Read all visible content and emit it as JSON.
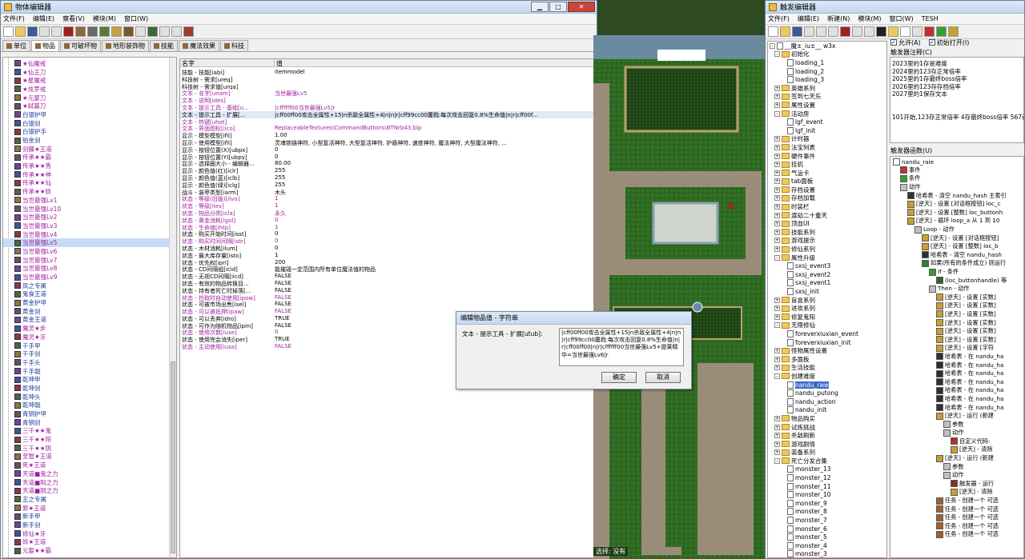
{
  "object_editor": {
    "title": "物体编辑器",
    "menu": [
      "文件(F)",
      "编辑(E)",
      "察看(V)",
      "模块(M)",
      "窗口(W)"
    ],
    "tabs": [
      "单位",
      "物品",
      "可破坏物",
      "地形装饰物",
      "技能",
      "魔法效果",
      "科技"
    ],
    "active_tab": "物品",
    "item_list": [
      "★仙魔戒",
      "★仙王刀",
      "★星魔戒",
      "★炫罗戒",
      "★元婴刀",
      "★弑墓刀",
      "白银护甲",
      "白银剑",
      "白银护手",
      "铂金剑",
      "剑藤★王道",
      "传承★★霸",
      "传承★★秀",
      "传承★★神",
      "传承★★仙",
      "传承★★妖",
      "当世最强Lv1",
      "当世最强Lv10",
      "当世最强Lv2",
      "当世最强Lv3",
      "当世最强Lv4",
      "当世最强Lv5",
      "当世最强Lv6",
      "当世最强Lv7",
      "当世最强Lv8",
      "当世最强Lv9",
      "凤之专属",
      "鬼食王道",
      "黄金护甲",
      "黄金剑",
      "黄金王道",
      "魔灵★步",
      "魔灵★牙",
      "千手甲",
      "千手剑",
      "千手头",
      "千手戟",
      "乾坤甲",
      "乾坤剑",
      "乾坤头",
      "乾坤戟",
      "青铜护甲",
      "青铜剑",
      "三千★★鬼",
      "三千★★阳",
      "三千★★阴",
      "至智★王道",
      "死★王道",
      "天道■鬼之力",
      "天道■阳之力",
      "天道■阴之力",
      "王之专属",
      "邪★王道",
      "新手甲",
      "新手剑",
      "修仙★牙",
      "妖★王道",
      "元婴★★霸"
    ],
    "selected_item": "当世最强Lv5",
    "grid_headers": [
      "名字",
      "值"
    ],
    "properties": [
      {
        "k": "技能 - 技能[iabi]",
        "v": "itemmodel",
        "mod": false
      },
      {
        "k": "科技树 - 需求[ureq]",
        "v": "",
        "mod": false
      },
      {
        "k": "科技树 - 需求值[urqa]",
        "v": "",
        "mod": false
      },
      {
        "k": "文本 - 名字[unam]",
        "v": "当世最强Lv5",
        "mod": true
      },
      {
        "k": "文本 - 说明[ides]",
        "v": "",
        "mod": true
      },
      {
        "k": "文本 - 提示工具 - 基础[u...",
        "v": "|cffffff00当世最强Lv5|r",
        "mod": true
      },
      {
        "k": "文本 - 提示工具 - 扩展[...",
        "v": "|cff00ff00攻击全属性+15|n杀敌全属性+4|n|n|r|cff99cc00屠戮:每次攻击回复0.8%生命值|n|r|cff00f...",
        "mod": false,
        "sel": true
      },
      {
        "k": "文本 - 热键[uhot]",
        "v": "",
        "mod": true
      },
      {
        "k": "文本 - 界面图标[iico]",
        "v": "ReplaceableTextures\\CommandButtons\\BTNrb43.blp",
        "mod": true
      },
      {
        "k": "显示 - 模型模型[ifil]",
        "v": "1.00",
        "mod": false
      },
      {
        "k": "显示 - 使用模型[ifil]",
        "v": "灵魂锁链神符, 小型复活神符, 大型复活神符, 护盾神符, 速度神符, 魔法神符, 大型魔法神符, ...",
        "mod": false
      },
      {
        "k": "显示 - 按钮位置(X)[ubpx]",
        "v": "0",
        "mod": false
      },
      {
        "k": "显示 - 按钮位置(Y)[ubpy]",
        "v": "0",
        "mod": false
      },
      {
        "k": "显示 - 选择圈大小 - 编辑器...",
        "v": "80.00",
        "mod": false
      },
      {
        "k": "显示 - 颜色值(红)[iclr]",
        "v": "255",
        "mod": false
      },
      {
        "k": "显示 - 颜色值(蓝)[iclb]",
        "v": "255",
        "mod": false
      },
      {
        "k": "显示 - 颜色值(绿)[iclg]",
        "v": "255",
        "mod": false
      },
      {
        "k": "战斗 - 装甲类型[iarm]",
        "v": "木头",
        "mod": false
      },
      {
        "k": "状态 - 等级(旧版)[ilvo]",
        "v": "1",
        "mod": true
      },
      {
        "k": "状态 - 等级[ilev]",
        "v": "1",
        "mod": true
      },
      {
        "k": "状态 - 物品分类[icla]",
        "v": "永久",
        "mod": true
      },
      {
        "k": "状态 - 黄金消耗[igol]",
        "v": "0",
        "mod": true
      },
      {
        "k": "状态 - 生命值[ihtp]",
        "v": "1",
        "mod": true
      },
      {
        "k": "状态 - 购买开始时间[isst]",
        "v": "0",
        "mod": false
      },
      {
        "k": "状态 - 购买时间间隔[istr]",
        "v": "0",
        "mod": true
      },
      {
        "k": "状态 - 木材消耗[ilum]",
        "v": "0",
        "mod": false
      },
      {
        "k": "状态 - 最大库存量[isto]",
        "v": "1",
        "mod": false
      },
      {
        "k": "状态 - 优先权[ipri]",
        "v": "200",
        "mod": false
      },
      {
        "k": "状态 - CD间隔组[icid]",
        "v": "能摧毁一定范围内所有单位魔法值的物品",
        "mod": false
      },
      {
        "k": "状态 - 无视CD间隔[iicd]",
        "v": "FALSE",
        "mod": false
      },
      {
        "k": "状态 - 有效的物品转换目...",
        "v": "FALSE",
        "mod": false
      },
      {
        "k": "状态 - 持有者死亡时掉落[...",
        "v": "FALSE",
        "mod": false
      },
      {
        "k": "状态 - 捡取时自动使用[ipow]",
        "v": "FALSE",
        "mod": true
      },
      {
        "k": "状态 - 可被市场出售[isel]",
        "v": "FALSE",
        "mod": false
      },
      {
        "k": "状态 - 可以被抵押[ipaw]",
        "v": "FALSE",
        "mod": true
      },
      {
        "k": "状态 - 可以丢弃[idro]",
        "v": "TRUE",
        "mod": false
      },
      {
        "k": "状态 - 可作为随机物品[iprn]",
        "v": "FALSE",
        "mod": false
      },
      {
        "k": "状态 - 使用次数[iuse]",
        "v": "0",
        "mod": true
      },
      {
        "k": "状态 - 使用完会消失[iper]",
        "v": "TRUE",
        "mod": false
      },
      {
        "k": "状态 - 主动使用[iusa]",
        "v": "FALSE",
        "mod": true
      }
    ]
  },
  "dialog": {
    "title": "编辑物品值 - 字符串",
    "label": "文本 - 提示工具 - 扩展[utub]:",
    "text": "|cff00ff00攻击全属性+15|n杀敌全属性+4|n|n|r|cff99cc00屠戮:每次攻击回复0.8%生命值|n|r|cff00ff00|n|r|cffffff00当世最强Lv5+提莱精华=当世最强Lv6|r",
    "ok": "确定",
    "cancel": "取消"
  },
  "trigger_editor": {
    "title": "触发编辑器",
    "menu": [
      "文件(F)",
      "编辑(E)",
      "新建(N)",
      "模块(M)",
      "窗口(W)",
      "TESH"
    ],
    "map_name": "__魔±_iu±__ w3x",
    "checkbox_enabled": "允许(A)",
    "checkbox_initial": "初始打开(I)",
    "comment_label": "触发器注释(C)",
    "comment_lines": [
      "2023里的1存是难度",
      "2024里的123存正常倍率",
      "2025里的1存最终boss倍率",
      "2026里的123存存档倍率",
      "2027里的1保存文本",
      "",
      "",
      "101开始,123存正常倍率 4存最终boss倍率 567存"
    ],
    "functions_label": "触发器函数(U)",
    "status": "选择: 没有",
    "tree": [
      {
        "t": "f",
        "l": "初始化",
        "d": 0,
        "e": "-"
      },
      {
        "t": "d",
        "l": "loading_1",
        "d": 1
      },
      {
        "t": "d",
        "l": "loading_2",
        "d": 1
      },
      {
        "t": "d",
        "l": "loading_3",
        "d": 1
      },
      {
        "t": "f",
        "l": "英雄系列",
        "d": 0,
        "e": "+"
      },
      {
        "t": "f",
        "l": "签到七天乐",
        "d": 0,
        "e": "+"
      },
      {
        "t": "f",
        "l": "属性设置",
        "d": 0,
        "e": "+"
      },
      {
        "t": "f",
        "l": "活动房",
        "d": 0,
        "e": "-"
      },
      {
        "t": "d",
        "l": "lgf_event",
        "d": 1
      },
      {
        "t": "d",
        "l": "lgf_init",
        "d": 1
      },
      {
        "t": "f",
        "l": "计时器",
        "d": 0,
        "e": "+"
      },
      {
        "t": "f",
        "l": "法宝列表",
        "d": 0,
        "e": "+"
      },
      {
        "t": "f",
        "l": "硬件事件",
        "d": 0,
        "e": "+"
      },
      {
        "t": "f",
        "l": "挂机",
        "d": 0,
        "e": "+"
      },
      {
        "t": "f",
        "l": "气运卡",
        "d": 0,
        "e": "+"
      },
      {
        "t": "f",
        "l": "tab面板",
        "d": 0,
        "e": "+"
      },
      {
        "t": "f",
        "l": "存档设置",
        "d": 0,
        "e": "+"
      },
      {
        "t": "f",
        "l": "存档加载",
        "d": 0,
        "e": "+"
      },
      {
        "t": "f",
        "l": "时装栏",
        "d": 0,
        "e": "+"
      },
      {
        "t": "f",
        "l": "渡劫二十重天",
        "d": 0,
        "e": "+"
      },
      {
        "t": "f",
        "l": "顶血UI",
        "d": 0,
        "e": "+"
      },
      {
        "t": "f",
        "l": "技能系列",
        "d": 0,
        "e": "+"
      },
      {
        "t": "f",
        "l": "游戏提示",
        "d": 0,
        "e": "+"
      },
      {
        "t": "f",
        "l": "修仙系列",
        "d": 0,
        "e": "+"
      },
      {
        "t": "f",
        "l": "属性升级",
        "d": 0,
        "e": "-"
      },
      {
        "t": "d",
        "l": "sxsj_event3",
        "d": 1
      },
      {
        "t": "d",
        "l": "sxsj_event2",
        "d": 1
      },
      {
        "t": "d",
        "l": "sxsj_event1",
        "d": 1
      },
      {
        "t": "d",
        "l": "sxsj_init",
        "d": 1
      },
      {
        "t": "f",
        "l": "盲盒系列",
        "d": 0,
        "e": "+"
      },
      {
        "t": "f",
        "l": "进攻系列",
        "d": 0,
        "e": "+"
      },
      {
        "t": "f",
        "l": "修复鬼阳",
        "d": 0,
        "e": "+"
      },
      {
        "t": "f",
        "l": "无限修仙",
        "d": 0,
        "e": "-"
      },
      {
        "t": "d",
        "l": "foreverxiuxian_event",
        "d": 1
      },
      {
        "t": "d",
        "l": "foreverxiuxian_init",
        "d": 1
      },
      {
        "t": "f",
        "l": "怪物属性设置",
        "d": 0,
        "e": "+"
      },
      {
        "t": "f",
        "l": "多面板",
        "d": 0,
        "e": "+"
      },
      {
        "t": "f",
        "l": "生活技能",
        "d": 0,
        "e": "+"
      },
      {
        "t": "f",
        "l": "创建难度",
        "d": 0,
        "e": "-"
      },
      {
        "t": "d",
        "l": "nandu_raie",
        "d": 1,
        "sel": true
      },
      {
        "t": "d",
        "l": "nandu_putong",
        "d": 1
      },
      {
        "t": "d",
        "l": "nandu_action",
        "d": 1
      },
      {
        "t": "d",
        "l": "nandu_init",
        "d": 1
      },
      {
        "t": "f",
        "l": "物品购买",
        "d": 0,
        "e": "+"
      },
      {
        "t": "f",
        "l": "试炼挑战",
        "d": 0,
        "e": "+"
      },
      {
        "t": "f",
        "l": "杀敌刷新",
        "d": 0,
        "e": "+"
      },
      {
        "t": "f",
        "l": "游戏剧情",
        "d": 0,
        "e": "+"
      },
      {
        "t": "f",
        "l": "装备系列",
        "d": 0,
        "e": "+"
      },
      {
        "t": "f",
        "l": "死亡分发合集",
        "d": 0,
        "e": "-"
      },
      {
        "t": "d",
        "l": "monster_13",
        "d": 1
      },
      {
        "t": "d",
        "l": "monster_12",
        "d": 1
      },
      {
        "t": "d",
        "l": "monster_11",
        "d": 1
      },
      {
        "t": "d",
        "l": "monster_10",
        "d": 1
      },
      {
        "t": "d",
        "l": "monster_9",
        "d": 1
      },
      {
        "t": "d",
        "l": "monster_8",
        "d": 1
      },
      {
        "t": "d",
        "l": "monster_7",
        "d": 1
      },
      {
        "t": "d",
        "l": "monster_6",
        "d": 1
      },
      {
        "t": "d",
        "l": "monster_5",
        "d": 1
      },
      {
        "t": "d",
        "l": "monster_4",
        "d": 1
      },
      {
        "t": "d",
        "l": "monster_3",
        "d": 1
      }
    ],
    "trigger_tree": [
      {
        "l": "nandu_raie",
        "d": 0,
        "c": "#ffffff"
      },
      {
        "l": "事件",
        "d": 1,
        "c": "#c03030"
      },
      {
        "l": "条件",
        "d": 1,
        "c": "#30a030"
      },
      {
        "l": "动作",
        "d": 1,
        "c": "#c0c0c0"
      },
      {
        "l": "哈希表 - 清空 nandu_hash  主索引",
        "d": 2,
        "c": "#303030"
      },
      {
        "l": "[逆天] - 设置 [对话框按钮] loc_c",
        "d": 2,
        "c": "#c8a030"
      },
      {
        "l": "[逆天] - 设置 [整数] loc_buttonh",
        "d": 2,
        "c": "#c8a030"
      },
      {
        "l": "[逆天] - 循环 loop_a 从 1 到 10",
        "d": 2,
        "c": "#c8a030"
      },
      {
        "l": "Loop - 动作",
        "d": 3,
        "c": "#c0c0c0"
      },
      {
        "l": "[逆天] - 设置 [对话框按钮] ",
        "d": 4,
        "c": "#c8a030"
      },
      {
        "l": "[逆天] - 设置 [整数] loc_b",
        "d": 4,
        "c": "#c8a030"
      },
      {
        "l": "哈希表 - 清空 nandu_hash",
        "d": 4,
        "c": "#303030"
      },
      {
        "l": "如果(所有的条件成立) 则运行",
        "d": 4,
        "c": "#308030"
      },
      {
        "l": "If - 条件",
        "d": 5,
        "c": "#30a030"
      },
      {
        "l": "(loc_buttonhandle) 等",
        "d": 6,
        "c": "#306030"
      },
      {
        "l": "Then - 动作",
        "d": 5,
        "c": "#c0c0c0"
      },
      {
        "l": "[逆天] - 设置 [实数]",
        "d": 6,
        "c": "#c8a030"
      },
      {
        "l": "[逆天] - 设置 [实数]",
        "d": 6,
        "c": "#c8a030"
      },
      {
        "l": "[逆天] - 设置 [实数]",
        "d": 6,
        "c": "#c8a030"
      },
      {
        "l": "[逆天] - 设置 [实数]",
        "d": 6,
        "c": "#c8a030"
      },
      {
        "l": "[逆天] - 设置 [实数]",
        "d": 6,
        "c": "#c8a030"
      },
      {
        "l": "[逆天] - 设置 [实数]",
        "d": 6,
        "c": "#c8a030"
      },
      {
        "l": "[逆天] - 设置 [字符",
        "d": 6,
        "c": "#c8a030"
      },
      {
        "l": "哈希表 - 在 nandu_ha",
        "d": 6,
        "c": "#303030"
      },
      {
        "l": "哈希表 - 在 nandu_ha",
        "d": 6,
        "c": "#303030"
      },
      {
        "l": "哈希表 - 在 nandu_ha",
        "d": 6,
        "c": "#303030"
      },
      {
        "l": "哈希表 - 在 nandu_ha",
        "d": 6,
        "c": "#303030"
      },
      {
        "l": "哈希表 - 在 nandu_ha",
        "d": 6,
        "c": "#303030"
      },
      {
        "l": "哈希表 - 在 nandu_ha",
        "d": 6,
        "c": "#303030"
      },
      {
        "l": "哈希表 - 在 nandu_ha",
        "d": 6,
        "c": "#303030"
      },
      {
        "l": "[逆天] - 运行 (新建",
        "d": 6,
        "c": "#c8a030"
      },
      {
        "l": "参数",
        "d": 7,
        "c": "#c0c0c0"
      },
      {
        "l": "动作",
        "d": 7,
        "c": "#c0c0c0"
      },
      {
        "l": "自定义代码:",
        "d": 8,
        "c": "#b03030"
      },
      {
        "l": "[逆天] - 清除",
        "d": 8,
        "c": "#c8a030"
      },
      {
        "l": "[逆天] - 运行 (新建",
        "d": 6,
        "c": "#c8a030"
      },
      {
        "l": "参数",
        "d": 7,
        "c": "#c0c0c0"
      },
      {
        "l": "动作",
        "d": 7,
        "c": "#c0c0c0"
      },
      {
        "l": "触发器 - 运行",
        "d": 8,
        "c": "#803030"
      },
      {
        "l": "[逆天] - 清除",
        "d": 8,
        "c": "#c8a030"
      },
      {
        "l": "任务 - 创建一个 可选",
        "d": 6,
        "c": "#a06030"
      },
      {
        "l": "任务 - 创建一个 可选",
        "d": 6,
        "c": "#a06030"
      },
      {
        "l": "任务 - 创建一个 可选",
        "d": 6,
        "c": "#a06030"
      },
      {
        "l": "任务 - 创建一个 可选",
        "d": 6,
        "c": "#a06030"
      },
      {
        "l": "任务 - 创建一个 可选",
        "d": 6,
        "c": "#a06030"
      }
    ]
  }
}
